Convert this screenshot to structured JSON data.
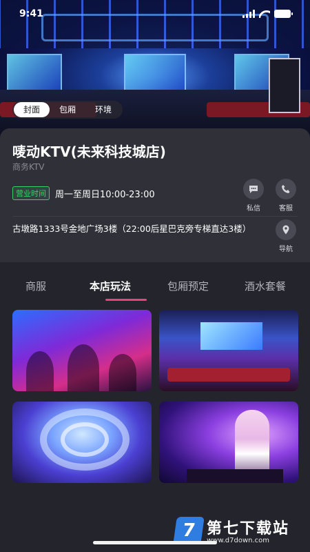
{
  "status_bar": {
    "time": "9:41"
  },
  "hero": {
    "media_tabs": [
      {
        "label": "封面",
        "active": true
      },
      {
        "label": "包厢",
        "active": false
      },
      {
        "label": "环境",
        "active": false
      }
    ]
  },
  "shop": {
    "name": "唛动KTV(未来科技城店)",
    "type": "商务KTV",
    "hours_badge": "营业时间",
    "hours": "周一至周日10:00-23:00",
    "address": "古墩路1333号金地广场3楼（22:00后星巴克旁专梯直达3楼）"
  },
  "actions": {
    "message": {
      "label": "私信",
      "icon": "chat-bubble-icon"
    },
    "service": {
      "label": "客服",
      "icon": "phone-icon"
    },
    "navigate": {
      "label": "导航",
      "icon": "map-pin-icon"
    }
  },
  "section_tabs": [
    {
      "label": "商服",
      "active": false
    },
    {
      "label": "本店玩法",
      "active": true
    },
    {
      "label": "包厢预定",
      "active": false
    },
    {
      "label": "酒水套餐",
      "active": false
    }
  ],
  "gallery": [
    {
      "subject": "party-crowd-photo"
    },
    {
      "subject": "private-room-photo"
    },
    {
      "subject": "futuristic-lounge-photo"
    },
    {
      "subject": "dj-performer-photo"
    }
  ],
  "watermark": {
    "mark": "7",
    "title": "第七下载站",
    "url": "www.d7down.com"
  },
  "colors": {
    "background": "#24252c",
    "card": "#2f3038",
    "accent": "#e8437c",
    "hours_green": "#3fcf6a"
  }
}
